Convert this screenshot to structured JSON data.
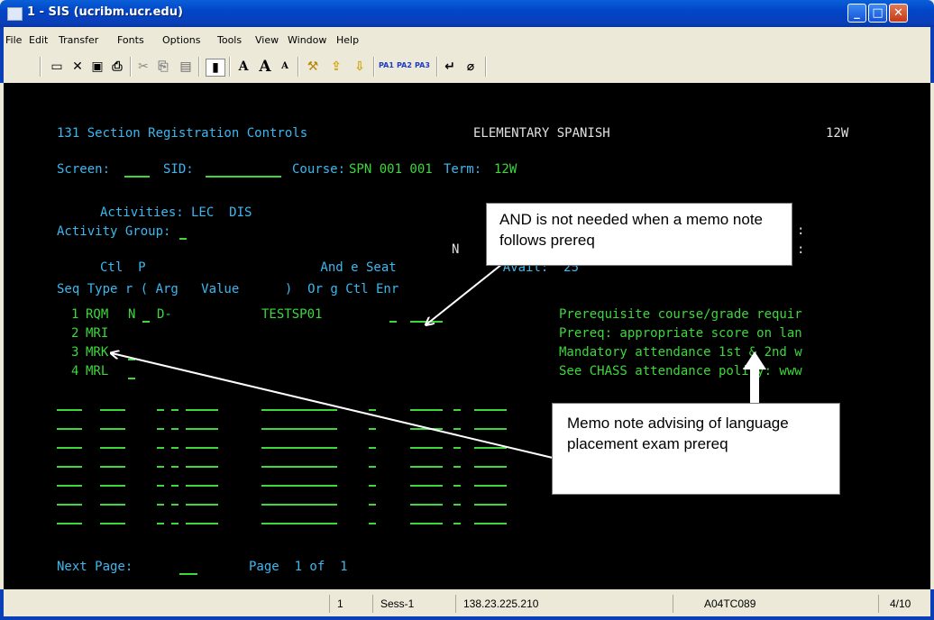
{
  "window": {
    "title": "1 - SIS (ucribm.ucr.edu)"
  },
  "menu": [
    "File",
    "Edit",
    "Transfer",
    "Fonts",
    "Options",
    "Tools",
    "View",
    "Window",
    "Help"
  ],
  "toolbar": {
    "pa_buttons": [
      "PA1",
      "PA2",
      "PA3"
    ]
  },
  "terminal": {
    "line_header_left": "131 Section Registration Controls",
    "line_header_center": "ELEMENTARY SPANISH",
    "line_header_right": "12W",
    "screen_label": "Screen:",
    "sid_label": "SID:",
    "course_label": "Course:",
    "course_value": "SPN 001 001",
    "term_label": "Term:",
    "term_value": "12W",
    "activities_label": "Activities:",
    "activities_value": "LEC  DIS",
    "activity_group_label": "Activity Group:",
    "hdr_n": "N",
    "hdr_colon1": ":",
    "hdr_colon2": ":",
    "hdr_row1": "Ctl  P                       And e Seat              Avail:  25",
    "hdr_row2": "Seq Type r ( Arg   Value      )  Or g Ctl Enr",
    "rows": [
      {
        "seq": "1",
        "type": "RQM",
        "r": "N",
        "arg": "D-",
        "value": "TESTSP01"
      },
      {
        "seq": "2",
        "type": "MRI",
        "r": "",
        "arg": "",
        "value": ""
      },
      {
        "seq": "3",
        "type": "MRK",
        "r": "",
        "arg": "",
        "value": ""
      },
      {
        "seq": "4",
        "type": "MRL",
        "r": "",
        "arg": "",
        "value": ""
      }
    ],
    "memo_lines": [
      "Prerequisite course/grade requir",
      "Prereq: appropriate score on lan",
      "Mandatory attendance 1st & 2nd w",
      "See CHASS attendance policy: www"
    ],
    "next_page_label": "Next Page:",
    "page_label": "Page  1 of  1"
  },
  "callouts": {
    "top": "AND  is not needed  when  a memo note follows prereq",
    "bottom": "Memo note advising of language placement exam prereq"
  },
  "status": {
    "cells": [
      "1",
      "Sess-1",
      "138.23.225.210",
      "A04TC089",
      "4/10"
    ]
  }
}
